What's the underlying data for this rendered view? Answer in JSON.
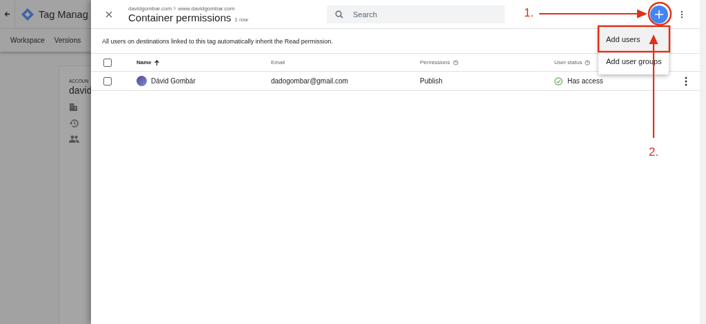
{
  "background_app": {
    "title": "Tag Manag",
    "nav_tabs": [
      {
        "label": "Workspace",
        "selected": false
      },
      {
        "label": "Versions",
        "selected": false
      }
    ],
    "account": {
      "label": "ACCOUN",
      "name": "david"
    }
  },
  "panel": {
    "breadcrumb": [
      "davidgombar.com",
      "www.davidgombar.com"
    ],
    "title": "Container permissions",
    "row_count": "1 row",
    "search": {
      "placeholder": "Search"
    },
    "notice": "All users on destinations linked to this tag automatically inherit the Read permission.",
    "select_all": {
      "checked": false
    },
    "columns": [
      {
        "label": "Name",
        "sorted": true,
        "help": false
      },
      {
        "label": "Email",
        "sorted": false,
        "help": false
      },
      {
        "label": "Permissions",
        "sorted": false,
        "help": true
      },
      {
        "label": "User status",
        "sorted": false,
        "help": true
      }
    ],
    "rows": [
      {
        "checked": false,
        "name": "Dávid Gombár",
        "email": "dadogombar@gmail.com",
        "permission": "Publish",
        "status": "Has access"
      }
    ],
    "menu": [
      {
        "label": "Add users",
        "selected": true
      },
      {
        "label": "Add user groups",
        "selected": false
      }
    ]
  },
  "annotations": [
    "1.",
    "2."
  ]
}
